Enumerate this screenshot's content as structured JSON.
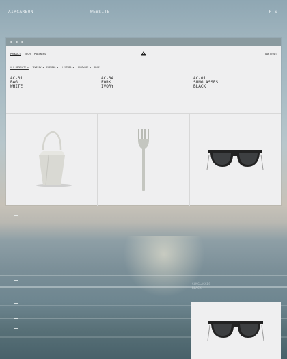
{
  "topbar": {
    "brand": "AIRCARBON",
    "site": "WEBSITE",
    "ps": "P.S"
  },
  "nav": {
    "items": [
      "PRODUCT",
      "TECH",
      "PARTNERS"
    ],
    "cart": "CART(01)"
  },
  "filters": [
    "ALL PRODUCTS •",
    "JEWELRY •",
    "EYEWEAR •",
    "LEATHER •",
    "FOODWARE •",
    "BAGS"
  ],
  "products": [
    {
      "code": "AC-01",
      "name": "BAG",
      "color": "WHITE"
    },
    {
      "code": "AC-04",
      "name": "FORK",
      "color": "IVORY"
    },
    {
      "code": "AC-01",
      "name": "SUNGLASSES",
      "color": "BLACK"
    }
  ],
  "ghost_text": {
    "line1": "SUNGLASSES",
    "line2": "BLACK"
  },
  "colors": {
    "panel": "#efeff0",
    "text": "#222222"
  }
}
